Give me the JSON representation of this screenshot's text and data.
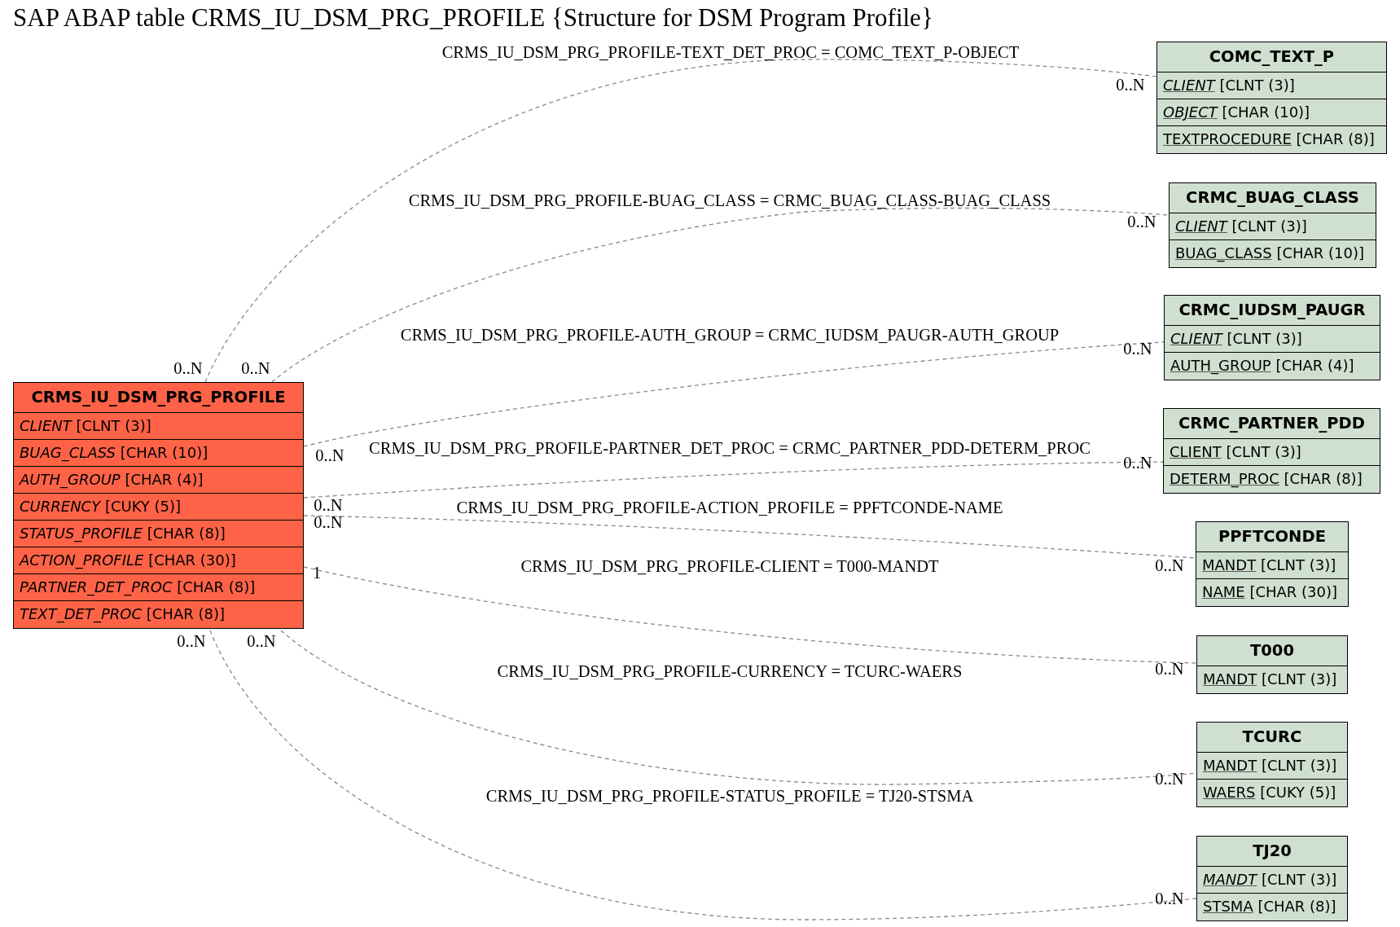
{
  "title": "SAP ABAP table CRMS_IU_DSM_PRG_PROFILE {Structure for DSM Program Profile}",
  "relations": [
    {
      "label": "CRMS_IU_DSM_PRG_PROFILE-TEXT_DET_PROC = COMC_TEXT_P-OBJECT",
      "source_cardinality": "0..N",
      "target_cardinality": "0..N"
    },
    {
      "label": "CRMS_IU_DSM_PRG_PROFILE-BUAG_CLASS = CRMC_BUAG_CLASS-BUAG_CLASS",
      "source_cardinality": "0..N",
      "target_cardinality": "0..N"
    },
    {
      "label": "CRMS_IU_DSM_PRG_PROFILE-AUTH_GROUP = CRMC_IUDSM_PAUGR-AUTH_GROUP",
      "source_cardinality": "0..N",
      "target_cardinality": "0..N"
    },
    {
      "label": "CRMS_IU_DSM_PRG_PROFILE-PARTNER_DET_PROC = CRMC_PARTNER_PDD-DETERM_PROC",
      "source_cardinality": "0..N",
      "target_cardinality": "0..N"
    },
    {
      "label": "CRMS_IU_DSM_PRG_PROFILE-ACTION_PROFILE = PPFTCONDE-NAME",
      "source_cardinality": "0..N",
      "target_cardinality": "0..N"
    },
    {
      "label": "CRMS_IU_DSM_PRG_PROFILE-CLIENT = T000-MANDT",
      "source_cardinality": "1",
      "target_cardinality": "0..N"
    },
    {
      "label": "CRMS_IU_DSM_PRG_PROFILE-CURRENCY = TCURC-WAERS",
      "source_cardinality": "0..N",
      "target_cardinality": "0..N"
    },
    {
      "label": "CRMS_IU_DSM_PRG_PROFILE-STATUS_PROFILE = TJ20-STSMA",
      "source_cardinality": "0..N",
      "target_cardinality": "0..N"
    }
  ],
  "main_table": {
    "name": "CRMS_IU_DSM_PRG_PROFILE",
    "fields": [
      {
        "name": "CLIENT",
        "type": "[CLNT (3)]",
        "key": false,
        "foreign_key": true
      },
      {
        "name": "BUAG_CLASS",
        "type": "[CHAR (10)]",
        "key": false,
        "foreign_key": true
      },
      {
        "name": "AUTH_GROUP",
        "type": "[CHAR (4)]",
        "key": false,
        "foreign_key": true
      },
      {
        "name": "CURRENCY",
        "type": "[CUKY (5)]",
        "key": false,
        "foreign_key": true
      },
      {
        "name": "STATUS_PROFILE",
        "type": "[CHAR (8)]",
        "key": false,
        "foreign_key": true
      },
      {
        "name": "ACTION_PROFILE",
        "type": "[CHAR (30)]",
        "key": false,
        "foreign_key": true
      },
      {
        "name": "PARTNER_DET_PROC",
        "type": "[CHAR (8)]",
        "key": false,
        "foreign_key": true
      },
      {
        "name": "TEXT_DET_PROC",
        "type": "[CHAR (8)]",
        "key": false,
        "foreign_key": true
      }
    ]
  },
  "related_tables": [
    {
      "name": "COMC_TEXT_P",
      "fields": [
        {
          "name": "CLIENT",
          "type": "[CLNT (3)]",
          "key": true,
          "foreign_key": true
        },
        {
          "name": "OBJECT",
          "type": "[CHAR (10)]",
          "key": true,
          "foreign_key": true
        },
        {
          "name": "TEXTPROCEDURE",
          "type": "[CHAR (8)]",
          "key": true,
          "foreign_key": false
        }
      ]
    },
    {
      "name": "CRMC_BUAG_CLASS",
      "fields": [
        {
          "name": "CLIENT",
          "type": "[CLNT (3)]",
          "key": true,
          "foreign_key": true
        },
        {
          "name": "BUAG_CLASS",
          "type": "[CHAR (10)]",
          "key": true,
          "foreign_key": false
        }
      ]
    },
    {
      "name": "CRMC_IUDSM_PAUGR",
      "fields": [
        {
          "name": "CLIENT",
          "type": "[CLNT (3)]",
          "key": true,
          "foreign_key": true
        },
        {
          "name": "AUTH_GROUP",
          "type": "[CHAR (4)]",
          "key": true,
          "foreign_key": false
        }
      ]
    },
    {
      "name": "CRMC_PARTNER_PDD",
      "fields": [
        {
          "name": "CLIENT",
          "type": "[CLNT (3)]",
          "key": true,
          "foreign_key": false
        },
        {
          "name": "DETERM_PROC",
          "type": "[CHAR (8)]",
          "key": true,
          "foreign_key": false
        }
      ]
    },
    {
      "name": "PPFTCONDE",
      "fields": [
        {
          "name": "MANDT",
          "type": "[CLNT (3)]",
          "key": true,
          "foreign_key": false
        },
        {
          "name": "NAME",
          "type": "[CHAR (30)]",
          "key": true,
          "foreign_key": false
        }
      ]
    },
    {
      "name": "T000",
      "fields": [
        {
          "name": "MANDT",
          "type": "[CLNT (3)]",
          "key": true,
          "foreign_key": false
        }
      ]
    },
    {
      "name": "TCURC",
      "fields": [
        {
          "name": "MANDT",
          "type": "[CLNT (3)]",
          "key": true,
          "foreign_key": false
        },
        {
          "name": "WAERS",
          "type": "[CUKY (5)]",
          "key": true,
          "foreign_key": false
        }
      ]
    },
    {
      "name": "TJ20",
      "fields": [
        {
          "name": "MANDT",
          "type": "[CLNT (3)]",
          "key": true,
          "foreign_key": true
        },
        {
          "name": "STSMA",
          "type": "[CHAR (8)]",
          "key": true,
          "foreign_key": false
        }
      ]
    }
  ]
}
